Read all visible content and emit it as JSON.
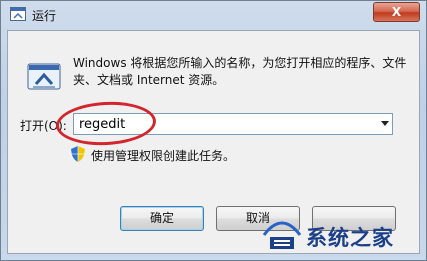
{
  "window": {
    "title": "运行",
    "close_symbol": "X"
  },
  "description": "Windows 将根据您所输入的名称，为您打开相应的程序、文件夹、文档或 Internet 资源。",
  "open": {
    "label": "打开(O):",
    "value": "regedit"
  },
  "admin_note": "使用管理权限创建此任务。",
  "buttons": {
    "ok": "确定",
    "cancel": "取消",
    "browse": ""
  },
  "watermark": {
    "text": "系统之家"
  },
  "colors": {
    "annotation": "#d2262e",
    "close": "#c03b1f",
    "watermark": "#1c3f8a"
  },
  "icons": [
    "run-app-icon",
    "shield-icon",
    "chevron-down-icon",
    "watermark-logo-icon"
  ]
}
